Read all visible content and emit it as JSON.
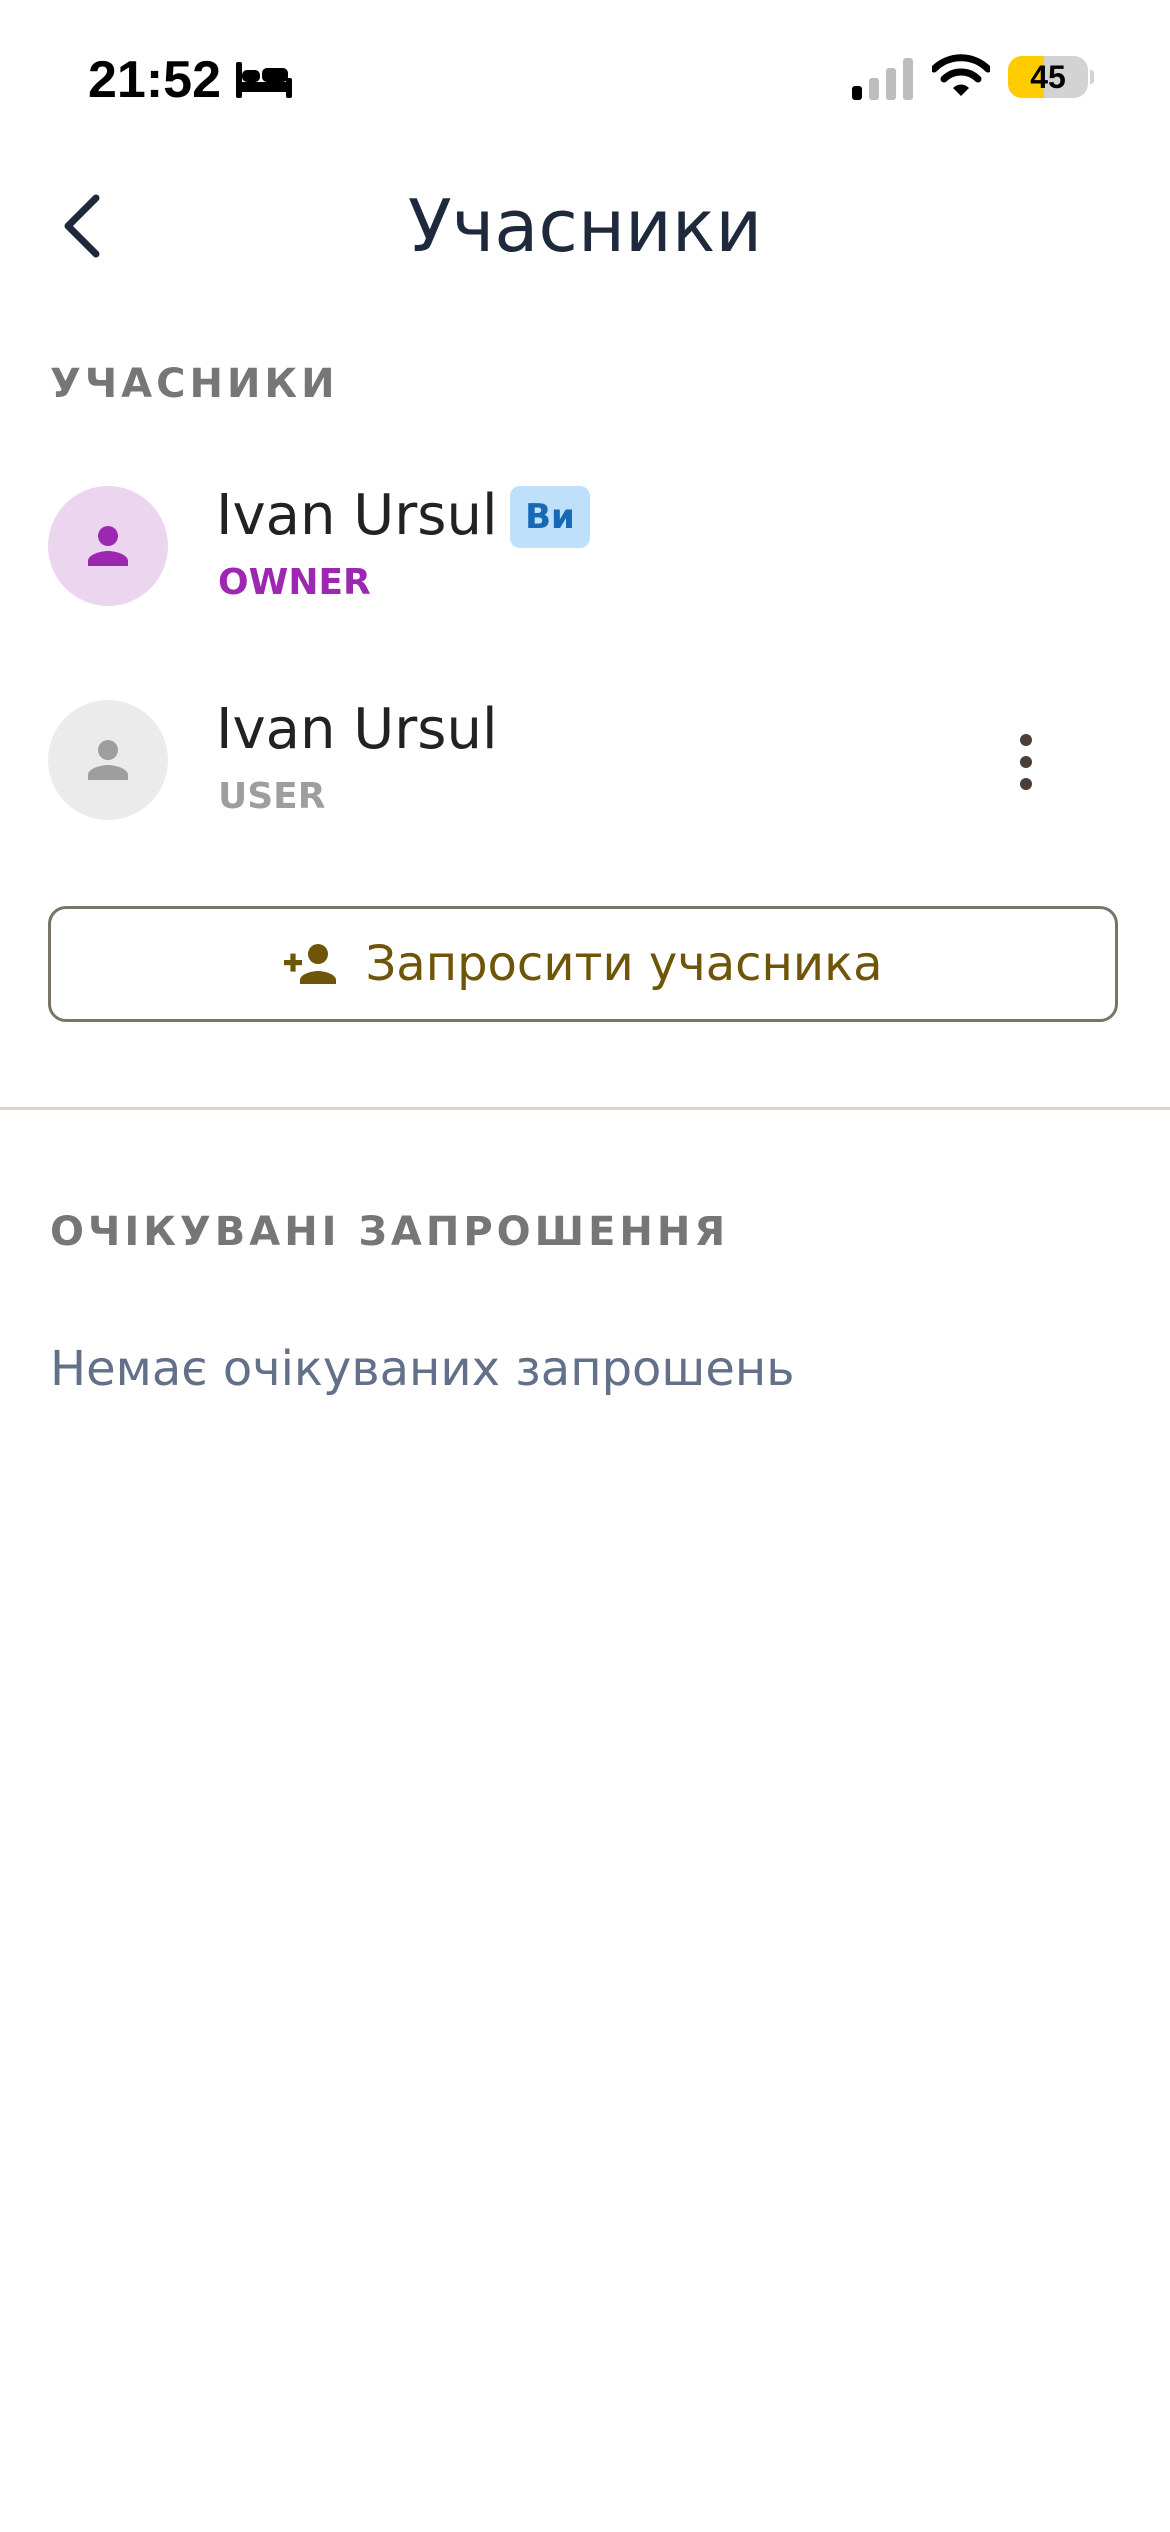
{
  "status_bar": {
    "time": "21:52",
    "battery_level": "45",
    "battery_fraction": 0.45,
    "icons": [
      "bed-icon",
      "cellular-signal-icon",
      "wifi-icon",
      "battery-icon"
    ]
  },
  "header": {
    "title": "Учасники",
    "back_icon": "chevron-left-icon"
  },
  "members_section": {
    "title": "УЧАСНИКИ",
    "members": [
      {
        "name": "Ivan Ursul",
        "role": "OWNER",
        "badge": "Ви",
        "avatar_icon": "person-icon",
        "role_color": "#9c27b0",
        "avatar_bg": "#ecd5ef",
        "avatar_fg": "#9c27b0"
      },
      {
        "name": "Ivan Ursul",
        "role": "USER",
        "avatar_icon": "person-icon",
        "more_icon": "more-vertical-icon",
        "role_color": "#9e9e9e",
        "avatar_bg": "#ebebeb",
        "avatar_fg": "#9e9e9e"
      }
    ],
    "invite_button": {
      "label": "Запросити учасника",
      "icon": "person-add-icon"
    }
  },
  "pending_section": {
    "title": "ОЧІКУВАНІ ЗАПРОШЕННЯ",
    "empty_text": "Немає очікуваних запрошень"
  },
  "colors": {
    "title": "#1e2a3b",
    "section_header": "#767676",
    "accent_gold": "#6e5508",
    "badge_bg": "#bfe0fb",
    "badge_text": "#1769b5",
    "empty_text": "#637089",
    "divider": "#ddd2cc"
  }
}
